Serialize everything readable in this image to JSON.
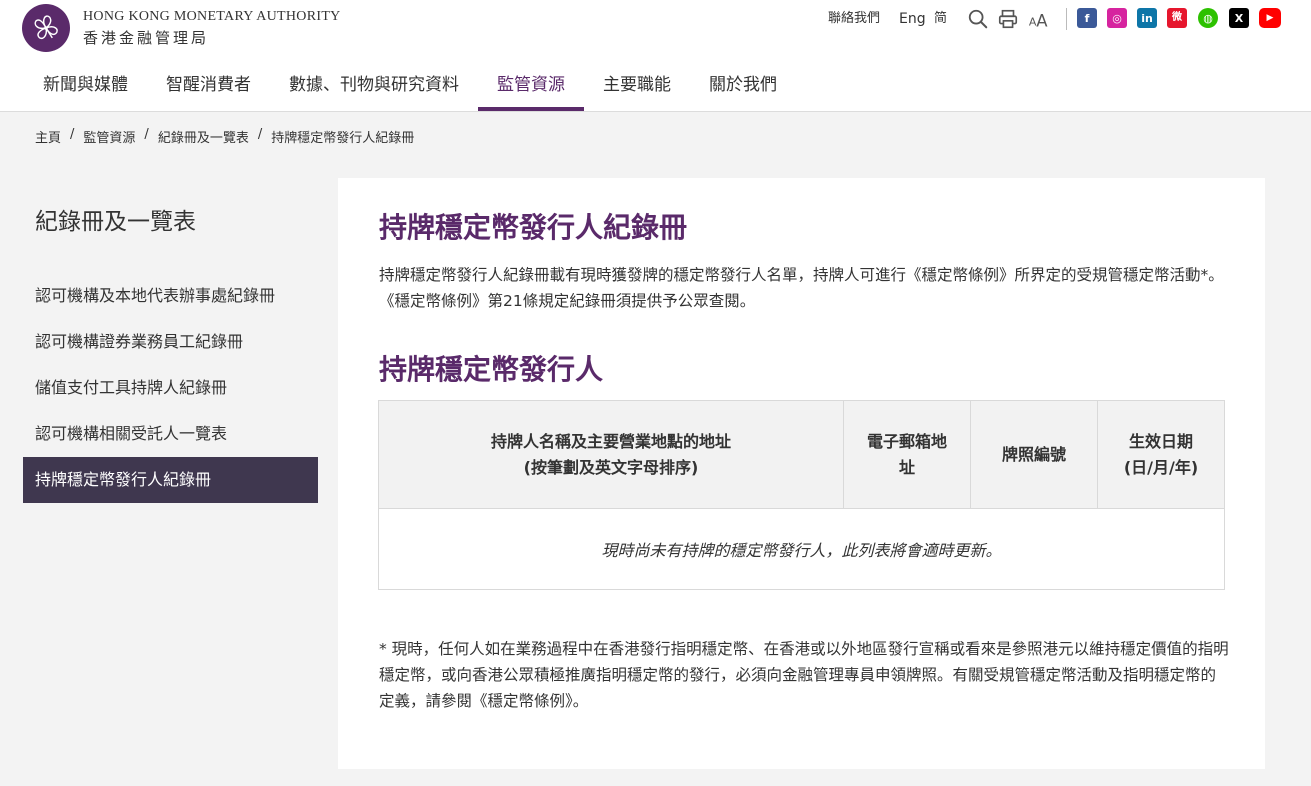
{
  "header": {
    "org_name_en": "HONG KONG MONETARY AUTHORITY",
    "org_name_zh": "香港金融管理局",
    "utility": {
      "contact": "聯絡我們",
      "english": "Eng",
      "simplified": "简"
    },
    "tools": [
      "search-icon",
      "print-icon",
      "font-size-icon"
    ],
    "social": [
      {
        "name": "facebook",
        "glyph": "f",
        "color": "#3b5998"
      },
      {
        "name": "instagram",
        "glyph": "◎",
        "color": "#d6249f"
      },
      {
        "name": "linkedin",
        "glyph": "in",
        "color": "#0e76a8"
      },
      {
        "name": "weibo",
        "glyph": "微",
        "color": "#e6162d"
      },
      {
        "name": "wechat",
        "glyph": "◍",
        "color": "#2dc100"
      },
      {
        "name": "x",
        "glyph": "𝕏",
        "color": "#000000"
      },
      {
        "name": "youtube",
        "glyph": "▶",
        "color": "#ff0000"
      }
    ]
  },
  "nav": {
    "items": [
      {
        "label": "新聞與媒體",
        "active": false
      },
      {
        "label": "智醒消費者",
        "active": false
      },
      {
        "label": "數據、刊物與研究資料",
        "active": false
      },
      {
        "label": "監管資源",
        "active": true
      },
      {
        "label": "主要職能",
        "active": false
      },
      {
        "label": "關於我們",
        "active": false
      }
    ]
  },
  "breadcrumb": {
    "items": [
      "主頁",
      "監管資源",
      "紀錄冊及一覽表",
      "持牌穩定幣發行人紀錄冊"
    ],
    "separator": "/"
  },
  "sidebar": {
    "title": "紀錄冊及一覽表",
    "items": [
      {
        "label": "認可機構及本地代表辦事處紀錄冊",
        "active": false
      },
      {
        "label": "認可機構證券業務員工紀錄冊",
        "active": false
      },
      {
        "label": "儲值支付工具持牌人紀錄冊",
        "active": false
      },
      {
        "label": "認可機構相關受託人一覽表",
        "active": false
      },
      {
        "label": "持牌穩定幣發行人紀錄冊",
        "active": true
      }
    ]
  },
  "main": {
    "title": "持牌穩定幣發行人紀錄冊",
    "intro": "持牌穩定幣發行人紀錄冊載有現時獲發牌的穩定幣發行人名單，持牌人可進行《穩定幣條例》所界定的受規管穩定幣活動*。《穩定幣條例》第21條規定紀錄冊須提供予公眾查閱。",
    "section_title": "持牌穩定幣發行人",
    "table": {
      "headers": [
        {
          "line1": "持牌人名稱及主要營業地點的地址",
          "line2": "(按筆劃及英文字母排序)"
        },
        {
          "line1": "電子郵箱地",
          "line2": "址"
        },
        {
          "line1": "牌照編號",
          "line2": ""
        },
        {
          "line1": "生效日期",
          "line2": "(日/月/年)"
        }
      ],
      "empty_message": "現時尚未有持牌的穩定幣發行人，此列表將會適時更新。"
    },
    "footnote": "* 現時，任何人如在業務過程中在香港發行指明穩定幣、在香港或以外地區發行宣稱或看來是參照港元以維持穩定價值的指明穩定幣，或向香港公眾積極推廣指明穩定幣的發行，必須向金融管理專員申領牌照。有關受規管穩定幣活動及指明穩定幣的定義，請參閱《穩定幣條例》。"
  },
  "colors": {
    "brand_purple": "#5a2a6a",
    "sidebar_active": "#3f374f"
  }
}
